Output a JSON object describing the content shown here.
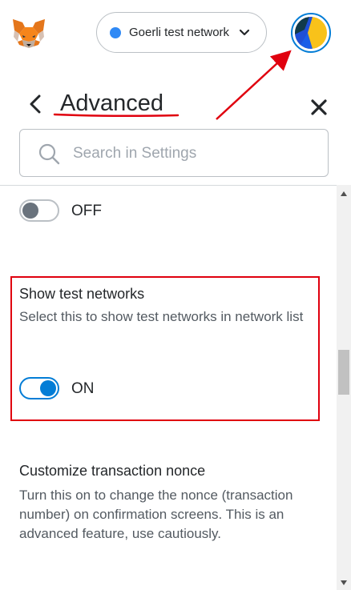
{
  "header": {
    "network_label": "Goerli test network",
    "network_dot_color": "#2f89f5",
    "accent_color": "#037dd6"
  },
  "page": {
    "title": "Advanced",
    "back_icon": "chevron-left-icon",
    "close_icon": "close-icon"
  },
  "search": {
    "placeholder": "Search in Settings",
    "value": ""
  },
  "settings": {
    "previous_toggle": {
      "state_label": "OFF",
      "on": false
    },
    "show_test_networks": {
      "title": "Show test networks",
      "description": "Select this to show test networks in network list",
      "state_label": "ON",
      "on": true
    },
    "customize_nonce": {
      "title": "Customize transaction nonce",
      "description": "Turn this on to change the nonce (transaction number) on confirmation screens. This is an advanced feature, use cautiously."
    }
  },
  "annotations": {
    "color": "#e0000e"
  }
}
